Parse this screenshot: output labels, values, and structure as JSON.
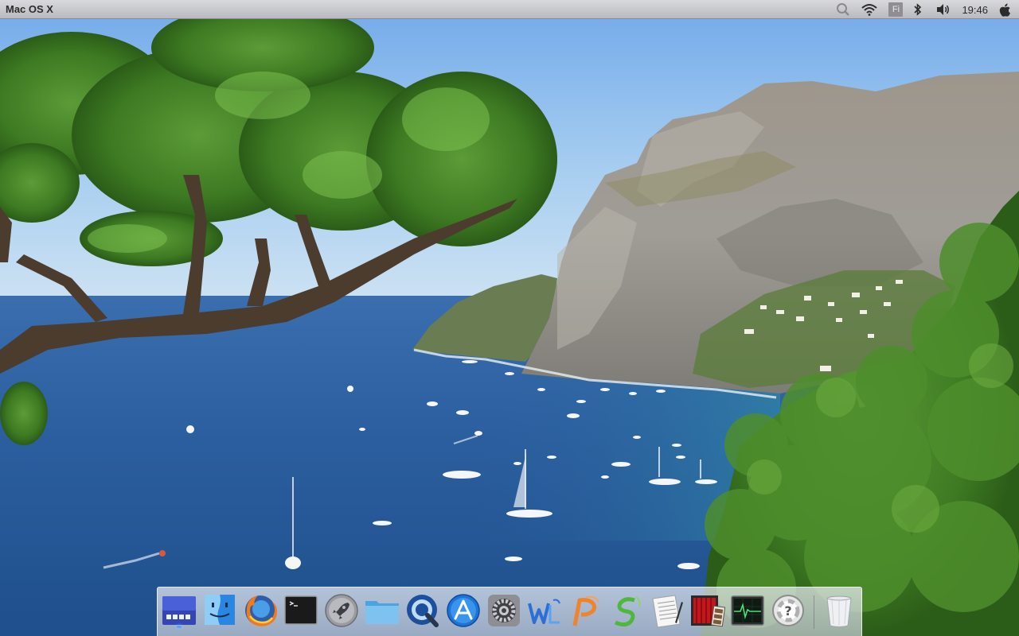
{
  "menubar": {
    "title": "Mac OS X",
    "keyboard_indicator": "Fi",
    "clock": "19:46",
    "status_icons": [
      "search-icon",
      "wifi-icon",
      "keyboard-layout-icon",
      "bluetooth-icon",
      "volume-icon",
      "clock",
      "apple-icon"
    ]
  },
  "dock": {
    "items": [
      {
        "name": "workspaces",
        "icon": "workspaces-icon",
        "running": true
      },
      {
        "name": "finder",
        "icon": "finder-icon",
        "running": false
      },
      {
        "name": "firefox",
        "icon": "firefox-icon",
        "running": false
      },
      {
        "name": "terminal",
        "icon": "terminal-icon",
        "running": false
      },
      {
        "name": "launchpad",
        "icon": "rocket-icon",
        "running": false
      },
      {
        "name": "files",
        "icon": "folder-icon",
        "running": false
      },
      {
        "name": "quicktime",
        "icon": "quicktime-icon",
        "running": false
      },
      {
        "name": "app-store",
        "icon": "app-store-icon",
        "running": false
      },
      {
        "name": "system-preferences",
        "icon": "gear-icon",
        "running": false
      },
      {
        "name": "writer",
        "icon": "writer-icon",
        "running": false
      },
      {
        "name": "presentation",
        "icon": "presentation-icon",
        "running": false
      },
      {
        "name": "spreadsheets",
        "icon": "spreadsheet-icon",
        "running": false
      },
      {
        "name": "text-editor",
        "icon": "notepad-icon",
        "running": false
      },
      {
        "name": "photo-booth",
        "icon": "photo-booth-icon",
        "running": false
      },
      {
        "name": "activity-monitor",
        "icon": "activity-monitor-icon",
        "running": false
      },
      {
        "name": "help",
        "icon": "help-icon",
        "running": false
      },
      {
        "name": "trash",
        "icon": "trash-icon",
        "running": false
      }
    ]
  },
  "colors": {
    "sky_top": "#7fb2ea",
    "sea": "#2a5a9a",
    "foliage": "#3f7f24",
    "cliff": "#8f8a80",
    "running_indicator": "#5aa0ff"
  }
}
